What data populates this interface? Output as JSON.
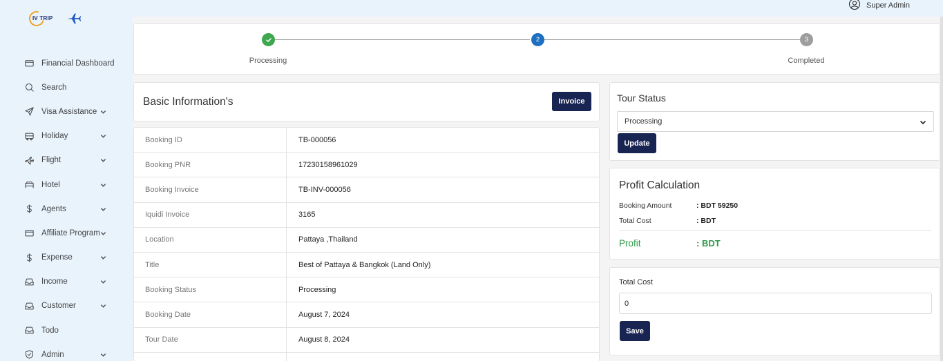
{
  "brand": {
    "logo_text": "IV TRIP"
  },
  "header": {
    "user_name": "Super Admin"
  },
  "sidebar": {
    "items": [
      {
        "label": "Financial Dashboard",
        "icon": "wallet-icon",
        "has_chevron": false
      },
      {
        "label": "Search",
        "icon": "search-icon",
        "has_chevron": false
      },
      {
        "label": "Visa Assistance",
        "icon": "send-icon",
        "has_chevron": true
      },
      {
        "label": "Holiday",
        "icon": "bus-icon",
        "has_chevron": true
      },
      {
        "label": "Flight",
        "icon": "plane-icon",
        "has_chevron": true
      },
      {
        "label": "Hotel",
        "icon": "bed-icon",
        "has_chevron": true
      },
      {
        "label": "Agents",
        "icon": "dollar-icon",
        "has_chevron": true
      },
      {
        "label": "Affiliate Program",
        "icon": "wallet-icon",
        "has_chevron": true
      },
      {
        "label": "Expense",
        "icon": "dollar-icon",
        "has_chevron": true
      },
      {
        "label": "Income",
        "icon": "inbox-icon",
        "has_chevron": true
      },
      {
        "label": "Customer",
        "icon": "inbox-icon",
        "has_chevron": true
      },
      {
        "label": "Todo",
        "icon": "inbox-icon",
        "has_chevron": false
      },
      {
        "label": "Admin",
        "icon": "shield-icon",
        "has_chevron": true
      }
    ]
  },
  "stepper": {
    "steps": [
      {
        "label": "Processing",
        "state": "done",
        "number": ""
      },
      {
        "label": "",
        "state": "active",
        "number": "2"
      },
      {
        "label": "Completed",
        "state": "pending",
        "number": "3"
      }
    ],
    "colors": {
      "done": "#3ea84f",
      "active": "#1e6fc0",
      "pending": "#9e9e9e"
    }
  },
  "basic": {
    "title": "Basic Information's",
    "invoice_label": "Invoice",
    "rows": [
      {
        "key": "Booking ID",
        "value": "TB-000056"
      },
      {
        "key": "Booking PNR",
        "value": "17230158961029"
      },
      {
        "key": "Booking Invoice",
        "value": "TB-INV-000056"
      },
      {
        "key": "Iquidi Invoice",
        "value": "3165"
      },
      {
        "key": "Location",
        "value": "Pattaya ,Thailand"
      },
      {
        "key": "Title",
        "value": "Best of Pattaya & Bangkok (Land Only)"
      },
      {
        "key": "Booking Status",
        "value": "Processing"
      },
      {
        "key": "Booking Date",
        "value": "August 7, 2024"
      },
      {
        "key": "Tour Date",
        "value": "August 8, 2024"
      },
      {
        "key": "",
        "value": ""
      }
    ]
  },
  "tour_status": {
    "title": "Tour Status",
    "selected": "Processing",
    "update_label": "Update"
  },
  "profit": {
    "title": "Profit Calculation",
    "booking_amount_label": "Booking Amount",
    "booking_amount_value": ": BDT 59250",
    "total_cost_label": "Total Cost",
    "total_cost_value": ": BDT",
    "profit_label": "Profit",
    "profit_value": ": BDT",
    "accent": "#2e9a48"
  },
  "cost": {
    "label": "Total Cost",
    "value": "0",
    "save_label": "Save"
  }
}
